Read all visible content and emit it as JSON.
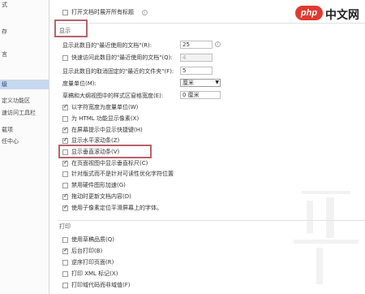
{
  "watermark": {
    "logo": "php",
    "text": "中文网"
  },
  "sidebar": {
    "items": [
      {
        "label": "式",
        "active": false
      },
      {
        "label": "存",
        "active": false
      },
      {
        "label": "言",
        "active": false
      },
      {
        "label": "级",
        "active": true
      },
      {
        "label": "定义功能区",
        "active": false
      },
      {
        "label": "速访问工具栏",
        "active": false
      },
      {
        "label": "载项",
        "active": false
      },
      {
        "label": "任中心",
        "active": false
      }
    ]
  },
  "top_option": {
    "label": "打开文档时展开所有标题",
    "checked": false
  },
  "display": {
    "title": "显示",
    "recent_docs": {
      "label": "显示此数目的\"最近使用的文档\"(R):",
      "value": "25"
    },
    "quick_access": {
      "label": "快速访问此数目的\"最近使用的文档\"(Q):",
      "value": "4",
      "checked": false
    },
    "recent_folders": {
      "label": "显示此数目的取消固定的\"最近的文件夹\"(F):",
      "value": "5"
    },
    "units": {
      "label": "度量单位(M):",
      "value": "厘米"
    },
    "draft_width": {
      "label": "草稿和大纲视图中的样式区窗格宽度(E):",
      "value": "0 厘米"
    },
    "checkboxes": [
      {
        "label": "以字符宽度为度量单位(W)",
        "checked": true
      },
      {
        "label": "为 HTML 功能显示像素(X)",
        "checked": false
      },
      {
        "label": "在屏幕提示中显示快捷键(H)",
        "checked": true
      },
      {
        "label": "显示水平滚动条(Z)",
        "checked": true
      },
      {
        "label": "显示垂直滚动条(V)",
        "checked": false
      },
      {
        "label": "在页面视图中显示垂直标尺(C)",
        "checked": true
      },
      {
        "label": "针对版式而不是针对可读性优化字符位置",
        "checked": false
      },
      {
        "label": "禁用硬件图形加速(G)",
        "checked": false
      },
      {
        "label": "拖动时更新文档内容(D)",
        "checked": true
      },
      {
        "label": "使用子像素定位平滑屏幕上的字体。",
        "checked": true
      }
    ]
  },
  "print": {
    "title": "打印",
    "checkboxes": [
      {
        "label": "使用草稿品质(Q)",
        "checked": false
      },
      {
        "label": "后台打印(B)",
        "checked": true
      },
      {
        "label": "逆序打印页面(R)",
        "checked": false
      },
      {
        "label": "打印 XML 标记(X)",
        "checked": false
      },
      {
        "label": "打印域代码而非域值(F)",
        "checked": false
      }
    ]
  }
}
